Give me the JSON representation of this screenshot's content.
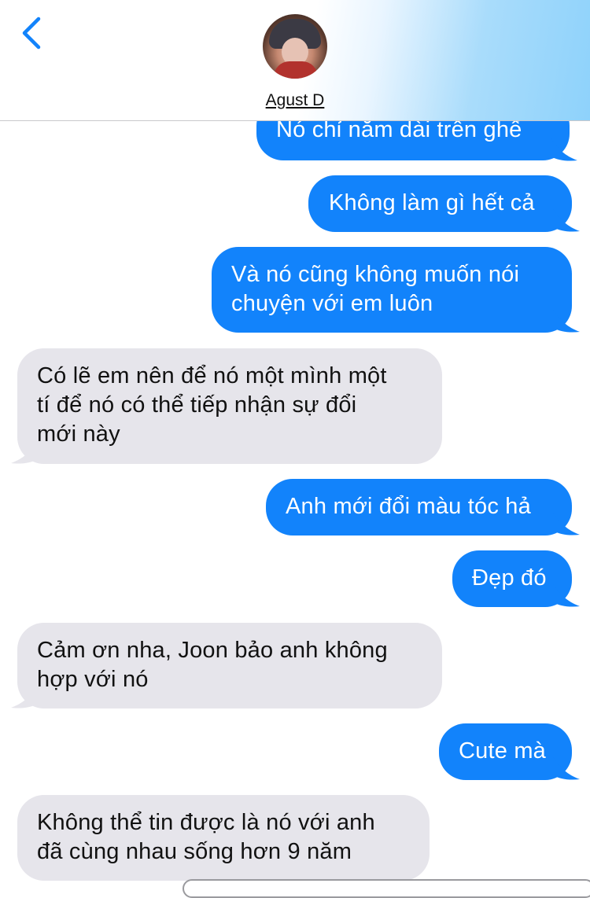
{
  "header": {
    "contact_name": "Agust D",
    "back_icon": "chevron-left-icon",
    "accent": "#1283fb"
  },
  "messages": [
    {
      "sender": "me",
      "text": "Nó chỉ nằm dài trên ghế"
    },
    {
      "sender": "me",
      "text": "Không làm gì hết cả"
    },
    {
      "sender": "me",
      "text": "Và nó cũng không muốn nói\nchuyện với em luôn"
    },
    {
      "sender": "them",
      "text": "Có lẽ em nên để nó một mình một\ntí để nó có thể tiếp nhận sự đổi\nmới này"
    },
    {
      "sender": "me",
      "text": "Anh mới đổi màu tóc hả"
    },
    {
      "sender": "me",
      "text": "Đẹp đó"
    },
    {
      "sender": "them",
      "text": "Cảm ơn nha, Joon bảo anh không\nhợp với nó"
    },
    {
      "sender": "me",
      "text": "Cute mà"
    },
    {
      "sender": "them",
      "text": "Không thể tin được là nó với anh\nđã cùng nhau sống hơn 9 năm"
    }
  ],
  "colors": {
    "sent_bubble": "#1283fb",
    "received_bubble": "#e6e5eb"
  }
}
